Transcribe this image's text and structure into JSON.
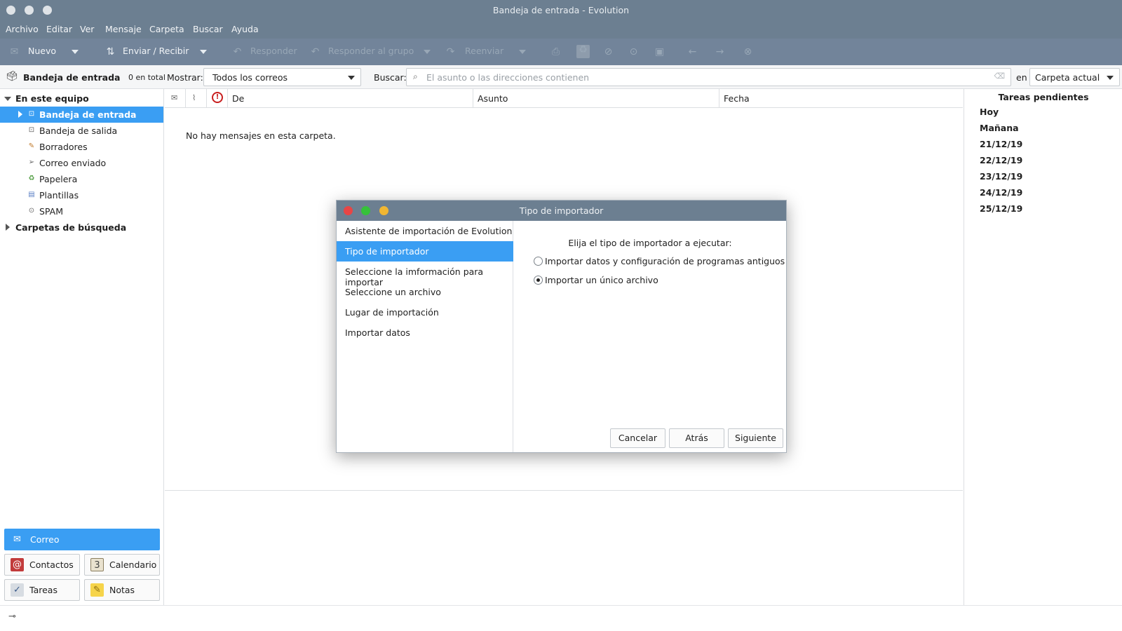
{
  "window": {
    "title": "Bandeja de entrada - Evolution"
  },
  "menubar": {
    "items": [
      "Archivo",
      "Editar",
      "Ver",
      "Mensaje",
      "Carpeta",
      "Buscar",
      "Ayuda"
    ]
  },
  "toolbar": {
    "new_label": "Nuevo",
    "send_receive_label": "Enviar / Recibir",
    "reply_label": "Responder",
    "reply_group_label": "Responder al grupo",
    "forward_label": "Reenviar"
  },
  "search_row": {
    "folder_title": "Bandeja de entrada",
    "folder_count": "0 en total",
    "show_label": "Mostrar:",
    "show_value": "Todos los correos",
    "search_label": "Buscar:",
    "search_placeholder": "El asunto o las direcciones contienen",
    "search_value": "",
    "in_label": "en",
    "scope_value": "Carpeta actual"
  },
  "sidebar": {
    "group_local": "En este equipo",
    "folders": [
      {
        "label": "Bandeja de entrada",
        "icon": "inbox-icon",
        "selected": true
      },
      {
        "label": "Bandeja de salida",
        "icon": "outbox-icon",
        "selected": false
      },
      {
        "label": "Borradores",
        "icon": "drafts-icon",
        "selected": false
      },
      {
        "label": "Correo enviado",
        "icon": "sent-icon",
        "selected": false
      },
      {
        "label": "Papelera",
        "icon": "trash-icon",
        "selected": false
      },
      {
        "label": "Plantillas",
        "icon": "templates-icon",
        "selected": false
      },
      {
        "label": "SPAM",
        "icon": "spam-icon",
        "selected": false
      }
    ],
    "group_search": "Carpetas de búsqueda"
  },
  "switcher": {
    "mail": "Correo",
    "contacts": "Contactos",
    "calendar": "Calendario",
    "tasks": "Tareas",
    "notes": "Notas"
  },
  "message_list": {
    "columns": {
      "from": "De",
      "subject": "Asunto",
      "date": "Fecha"
    },
    "empty_text": "No hay mensajes en esta carpeta."
  },
  "tasks_pane": {
    "heading": "Tareas pendientes",
    "days": [
      "Hoy",
      "Mañana",
      "21/12/19",
      "22/12/19",
      "23/12/19",
      "24/12/19",
      "25/12/19"
    ]
  },
  "dialog": {
    "title": "Tipo de importador",
    "steps": [
      "Asistente de importación de Evolution",
      "Tipo de importador",
      "Seleccione la imformación para importar",
      "Seleccione un archivo",
      "Lugar de importación",
      "Importar datos"
    ],
    "current_step": 1,
    "prompt": "Elija el tipo de importador a ejecutar:",
    "options": [
      {
        "label": "Importar datos y configuración de programas antiguos",
        "checked": false
      },
      {
        "label": "Importar un único archivo",
        "checked": true
      }
    ],
    "buttons": {
      "cancel": "Cancelar",
      "back": "Atrás",
      "next": "Siguiente"
    }
  },
  "colors": {
    "titlebar": "#6c7f91",
    "accent": "#3a9ef3",
    "close_dot": "#e84545",
    "max_dot": "#36c23a",
    "min_dot": "#f0b632"
  }
}
